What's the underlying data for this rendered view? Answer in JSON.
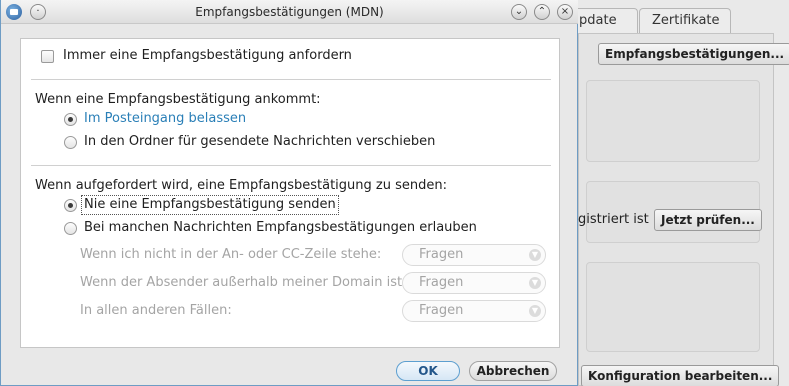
{
  "background_window": {
    "tabs": [
      "pdate",
      "Zertifikate"
    ],
    "mdn_button": "Empfangsbestätigungen...",
    "registered_text": "gistriert ist",
    "check_now_button": "Jetzt prüfen...",
    "config_button": "Konfiguration bearbeiten..."
  },
  "dialog": {
    "title": "Empfangsbestätigungen (MDN)",
    "always_request": {
      "label": "Immer eine Empfangsbestätigung anfordern",
      "checked": false
    },
    "on_receipt": {
      "heading": "Wenn eine Empfangsbestätigung ankommt:",
      "options": [
        {
          "label": "Im Posteingang belassen",
          "selected": true
        },
        {
          "label": "In den Ordner für gesendete Nachrichten verschieben",
          "selected": false
        }
      ]
    },
    "on_request": {
      "heading": "Wenn aufgefordert wird, eine Empfangsbestätigung zu senden:",
      "options": [
        {
          "label": "Nie eine Empfangsbestätigung senden",
          "selected": true
        },
        {
          "label": "Bei manchen Nachrichten Empfangsbestätigungen erlauben",
          "selected": false
        }
      ],
      "conditions": [
        {
          "label": "Wenn ich nicht in der An- oder CC-Zeile stehe:",
          "value": "Fragen"
        },
        {
          "label": "Wenn der Absender außerhalb meiner Domain ist:",
          "value": "Fragen"
        },
        {
          "label": "In allen anderen Fällen:",
          "value": "Fragen"
        }
      ]
    },
    "ok_label": "OK",
    "cancel_label": "Abbrechen"
  }
}
